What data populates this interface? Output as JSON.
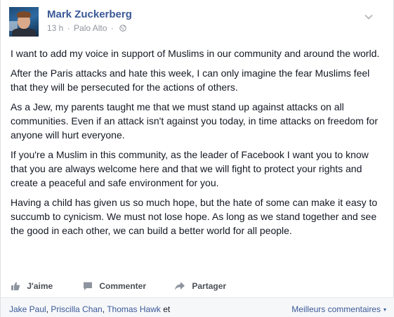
{
  "post": {
    "author": "Mark Zuckerberg",
    "time": "13 h",
    "separator": "·",
    "location": "Palo Alto",
    "separator2": "·",
    "privacy_icon": "globe-icon",
    "menu_icon": "chevron-down-icon",
    "paragraphs": [
      "I want to add my voice in support of Muslims in our community and around the world.",
      "After the Paris attacks and hate this week, I can only imagine the fear Muslims feel that they will be persecuted for the actions of others.",
      "As a Jew, my parents taught me that we must stand up against attacks on all communities. Even if an attack isn't against you today, in time attacks on freedom for anyone will hurt everyone.",
      "If you're a Muslim in this community, as the leader of Facebook I want you to know that you are always welcome here and that we will fight to protect your rights and create a peaceful and safe environment for you.",
      "Having a child has given us so much hope, but the hate of some can make it easy to succumb to cynicism. We must not lose hope. As long as we stand together and see the good in each other, we can build a better world for all people."
    ]
  },
  "actions": {
    "like": {
      "label": "J'aime",
      "icon": "thumbs-up-icon"
    },
    "comment": {
      "label": "Commenter",
      "icon": "comment-icon"
    },
    "share": {
      "label": "Partager",
      "icon": "share-arrow-icon"
    }
  },
  "footer": {
    "likers": [
      "Jake Paul",
      "Priscilla Chan",
      "Thomas Hawk"
    ],
    "likers_sep": ", ",
    "likers_and": "et",
    "sort_label": "Meilleurs commentaires",
    "sort_caret": "▾"
  },
  "colors": {
    "link": "#3b5998",
    "text": "#141823",
    "meta": "#90949c",
    "action": "#4b4f56",
    "footer_bg": "#f6f7f9"
  }
}
